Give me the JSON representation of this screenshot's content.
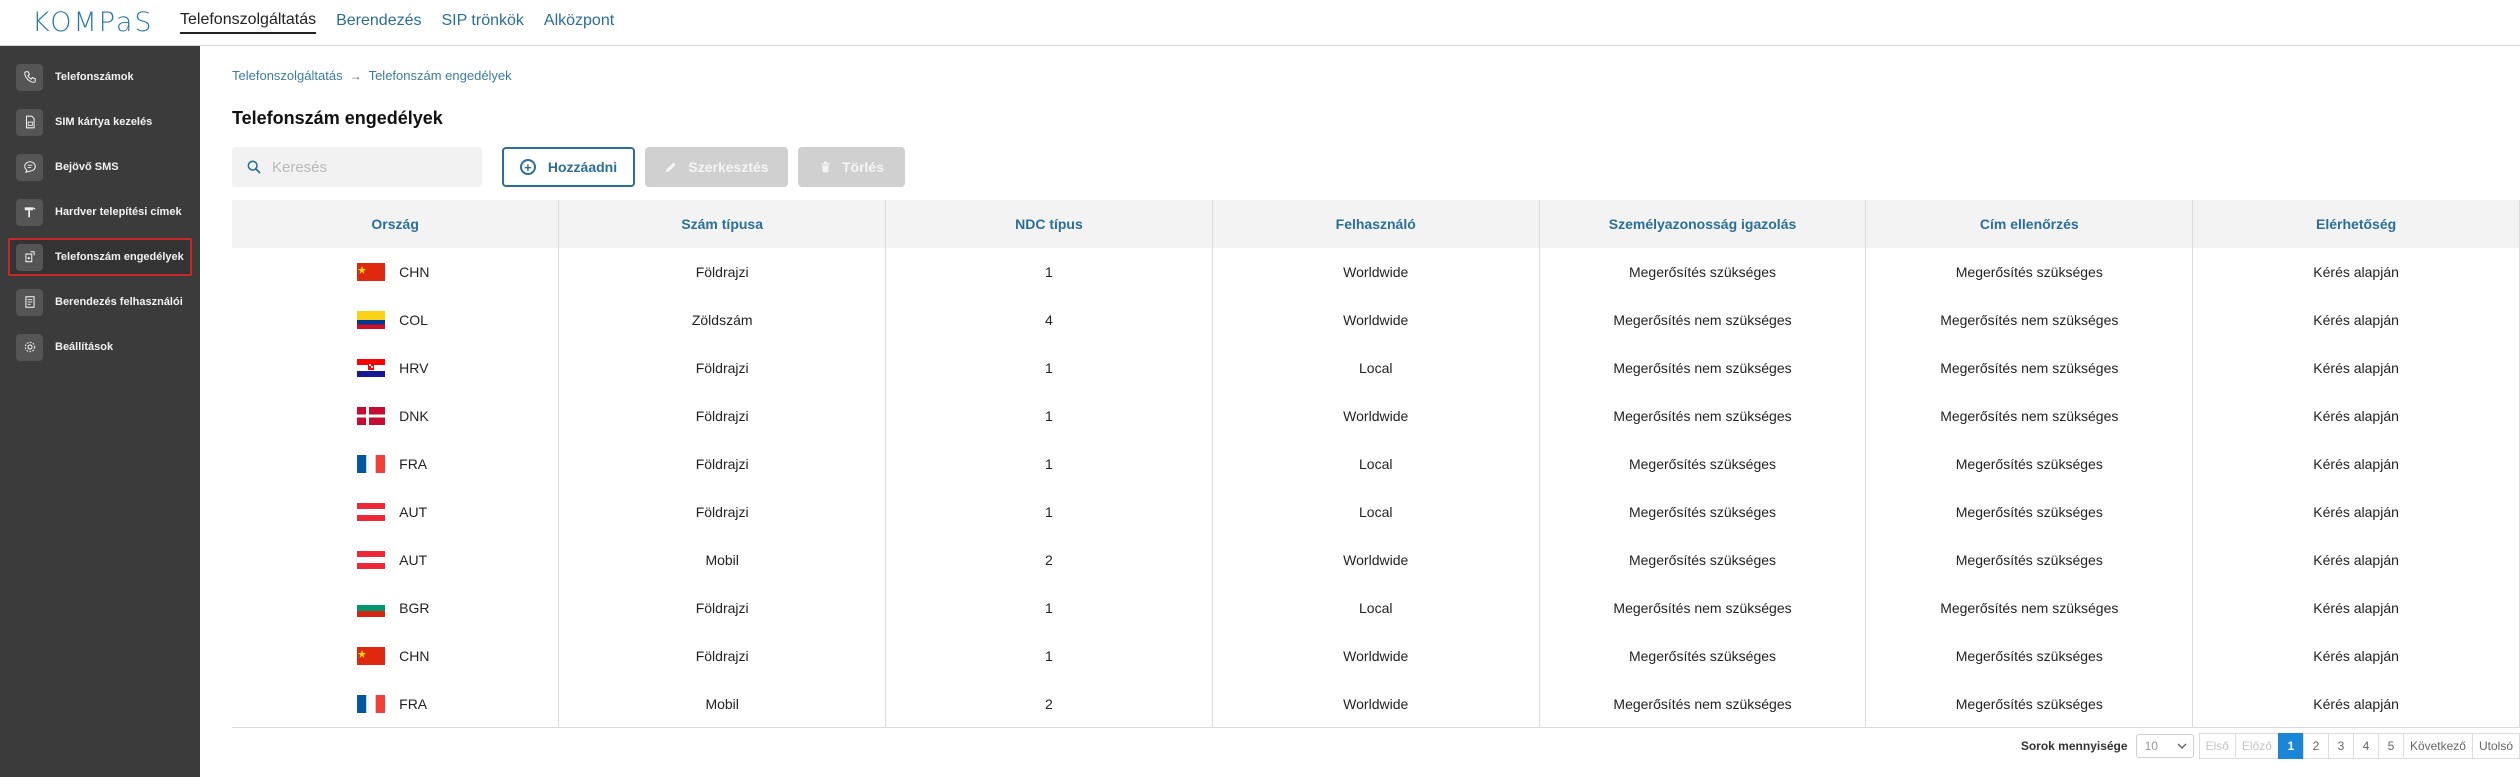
{
  "app": {
    "logo_text": "KOMPaS",
    "brand_color": "#2a7aa8"
  },
  "topnav": {
    "items": [
      {
        "label": "Telefonszolgáltatás",
        "active": true
      },
      {
        "label": "Berendezés",
        "active": false
      },
      {
        "label": "SIP trönkök",
        "active": false
      },
      {
        "label": "Alközpont",
        "active": false
      }
    ]
  },
  "sidebar": {
    "items": [
      {
        "label": "Telefonszámok",
        "icon": "phone-icon"
      },
      {
        "label": "SIM kártya kezelés",
        "icon": "sim-card-icon"
      },
      {
        "label": "Bejövő SMS",
        "icon": "message-icon"
      },
      {
        "label": "Hardver telepítési címek",
        "icon": "hammer-icon"
      },
      {
        "label": "Telefonszám engedélyek",
        "icon": "phone-permission-icon",
        "active": true
      },
      {
        "label": "Berendezés felhasználói",
        "icon": "document-icon"
      },
      {
        "label": "Beállítások",
        "icon": "gear-icon"
      }
    ]
  },
  "breadcrumb": {
    "parent": "Telefonszolgáltatás",
    "current": "Telefonszám engedélyek"
  },
  "page": {
    "title": "Telefonszám engedélyek"
  },
  "toolbar": {
    "search_placeholder": "Keresés",
    "add_label": "Hozzáadni",
    "edit_label": "Szerkesztés",
    "delete_label": "Törlés"
  },
  "table": {
    "columns": [
      "Ország",
      "Szám típusa",
      "NDC típus",
      "Felhasználó",
      "Személyazonosság igazolás",
      "Cím ellenőrzés",
      "Elérhetőség"
    ],
    "rows": [
      {
        "country": "CHN",
        "flag": "chn",
        "type": "Földrajzi",
        "ndc": "1",
        "user": "Worldwide",
        "identity": "Megerősítés szükséges",
        "address": "Megerősítés szükséges",
        "availability": "Kérés alapján"
      },
      {
        "country": "COL",
        "flag": "col",
        "type": "Zöldszám",
        "ndc": "4",
        "user": "Worldwide",
        "identity": "Megerősítés nem szükséges",
        "address": "Megerősítés nem szükséges",
        "availability": "Kérés alapján"
      },
      {
        "country": "HRV",
        "flag": "hrv",
        "type": "Földrajzi",
        "ndc": "1",
        "user": "Local",
        "identity": "Megerősítés nem szükséges",
        "address": "Megerősítés nem szükséges",
        "availability": "Kérés alapján"
      },
      {
        "country": "DNK",
        "flag": "dnk",
        "type": "Földrajzi",
        "ndc": "1",
        "user": "Worldwide",
        "identity": "Megerősítés nem szükséges",
        "address": "Megerősítés nem szükséges",
        "availability": "Kérés alapján"
      },
      {
        "country": "FRA",
        "flag": "fra",
        "type": "Földrajzi",
        "ndc": "1",
        "user": "Local",
        "identity": "Megerősítés szükséges",
        "address": "Megerősítés szükséges",
        "availability": "Kérés alapján"
      },
      {
        "country": "AUT",
        "flag": "aut",
        "type": "Földrajzi",
        "ndc": "1",
        "user": "Local",
        "identity": "Megerősítés szükséges",
        "address": "Megerősítés szükséges",
        "availability": "Kérés alapján"
      },
      {
        "country": "AUT",
        "flag": "aut",
        "type": "Mobil",
        "ndc": "2",
        "user": "Worldwide",
        "identity": "Megerősítés szükséges",
        "address": "Megerősítés szükséges",
        "availability": "Kérés alapján"
      },
      {
        "country": "BGR",
        "flag": "bgr",
        "type": "Földrajzi",
        "ndc": "1",
        "user": "Local",
        "identity": "Megerősítés nem szükséges",
        "address": "Megerősítés nem szükséges",
        "availability": "Kérés alapján"
      },
      {
        "country": "CHN",
        "flag": "chn",
        "type": "Földrajzi",
        "ndc": "1",
        "user": "Worldwide",
        "identity": "Megerősítés szükséges",
        "address": "Megerősítés szükséges",
        "availability": "Kérés alapján"
      },
      {
        "country": "FRA",
        "flag": "fra",
        "type": "Mobil",
        "ndc": "2",
        "user": "Worldwide",
        "identity": "Megerősítés nem szükséges",
        "address": "Megerősítés szükséges",
        "availability": "Kérés alapján"
      }
    ]
  },
  "pagination": {
    "rows_label": "Sorok mennyisége",
    "page_size": "10",
    "first": "Első",
    "prev": "Előző",
    "pages": [
      "1",
      "2",
      "3",
      "4",
      "5"
    ],
    "current_page": "1",
    "next": "Következő",
    "last": "Utolsó",
    "accent_color": "#1a86d6"
  }
}
